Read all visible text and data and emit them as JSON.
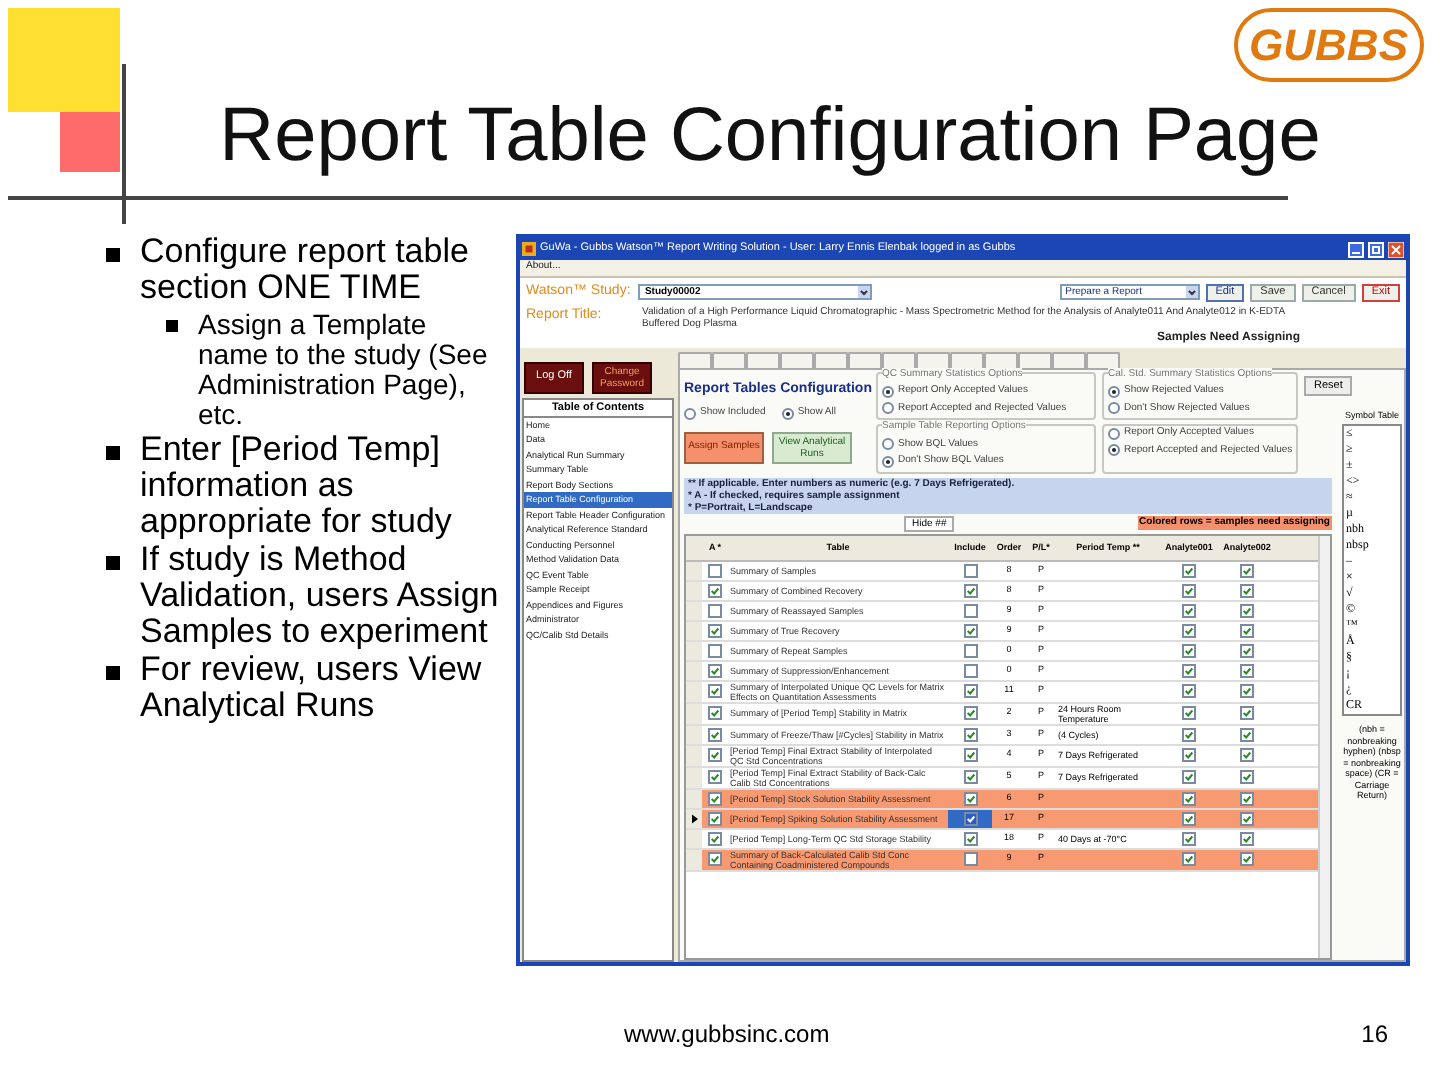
{
  "slide": {
    "logo": "GUBBS",
    "title": "Report Table Configuration Page",
    "bullets": [
      {
        "text": "Configure report table section ONE TIME",
        "children": [
          {
            "text": "Assign a Template name to the study (See Administration Page), etc."
          }
        ]
      },
      {
        "text": "Enter [Period Temp] information as appropriate for study"
      },
      {
        "text": "If study is Method Validation, users Assign Samples to experiment"
      },
      {
        "text": "For review, users View Analytical Runs"
      }
    ],
    "footer_url": "www.gubbsinc.com",
    "page_number": "16"
  },
  "app": {
    "title": "GuWa - Gubbs Watson™ Report Writing Solution - User: Larry Ennis Elenbak logged in as Gubbs",
    "menu": [
      "About..."
    ],
    "study_label": "Watson™ Study:",
    "study_value": "Study00002",
    "action_value": "Prepare a Report",
    "buttons": [
      {
        "label": "Edit",
        "kind": "edit"
      },
      {
        "label": "Save",
        "kind": "plain"
      },
      {
        "label": "Cancel",
        "kind": "plain"
      },
      {
        "label": "Exit",
        "kind": "exit"
      }
    ],
    "report_title_label": "Report Title:",
    "report_title": "Validation of a High Performance Liquid Chromatographic - Mass Spectrometric Method for the Analysis of Analyte011 And Analyte012 in K-EDTA Buffered Dog Plasma",
    "status": "Samples Need Assigning",
    "log_off": "Log Off",
    "change_password": "Change Password",
    "toc_title": "Table of Contents",
    "toc": [
      {
        "label": "Home",
        "selected": false
      },
      {
        "label": "Data",
        "selected": false
      },
      {
        "label": "Analytical Run Summary",
        "selected": false
      },
      {
        "label": "Summary Table",
        "selected": false
      },
      {
        "label": "Report Body Sections",
        "selected": false
      },
      {
        "label": "Report Table Configuration",
        "selected": true
      },
      {
        "label": "Report Table Header Configuration",
        "selected": false
      },
      {
        "label": "Analytical Reference Standard",
        "selected": false
      },
      {
        "label": "Conducting Personnel",
        "selected": false
      },
      {
        "label": "Method Validation Data",
        "selected": false
      },
      {
        "label": "QC Event Table",
        "selected": false
      },
      {
        "label": "Sample Receipt",
        "selected": false
      },
      {
        "label": "Appendices and Figures",
        "selected": false
      },
      {
        "label": "Administrator",
        "selected": false
      },
      {
        "label": "QC/Calib Std Details",
        "selected": false
      }
    ],
    "section_title": "Report Tables Configuration",
    "view_filter": [
      {
        "label": "Show Included",
        "selected": false
      },
      {
        "label": "Show All",
        "selected": true
      }
    ],
    "assign_samples": "Assign Samples",
    "view_runs": "View Analytical Runs",
    "option_groups": [
      {
        "title": "QC Summary Statistics Options",
        "options": [
          {
            "label": "Report Only Accepted Values",
            "selected": true
          },
          {
            "label": "Report Accepted and Rejected Values",
            "selected": false
          }
        ]
      },
      {
        "title": "Cal. Std. Summary Statistics Options",
        "options": [
          {
            "label": "Show Rejected Values",
            "selected": true
          },
          {
            "label": "Don't Show Rejected Values",
            "selected": false
          }
        ]
      },
      {
        "title": "Sample Table Reporting Options",
        "options": [
          {
            "label": "Show BQL Values",
            "selected": false
          },
          {
            "label": "Don't Show BQL Values",
            "selected": true
          }
        ]
      },
      {
        "options": [
          {
            "label": "Report Only Accepted Values",
            "selected": false
          },
          {
            "label": "Report Accepted and Rejected Values",
            "selected": true
          }
        ]
      }
    ],
    "reset": "Reset",
    "notes": [
      "** If applicable. Enter numbers as numeric (e.g. 7 Days Refrigerated).",
      "* A - If checked, requires sample assignment",
      "* P=Portrait, L=Landscape"
    ],
    "hide_button": "Hide ##",
    "legend": "Colored rows = samples need assigning",
    "columns": [
      "A *",
      "Table",
      "Include",
      "Order",
      "P/L*",
      "Period Temp **",
      "Analyte001",
      "Analyte002"
    ],
    "rows": [
      {
        "a": false,
        "table": "Summary of Samples",
        "include": false,
        "order": "8",
        "pl": "P",
        "a1": true,
        "a2": true,
        "needs_assigning": false,
        "selected": false
      },
      {
        "a": true,
        "table": "Summary of Combined Recovery",
        "include": true,
        "order": "8",
        "pl": "P",
        "a1": true,
        "a2": true,
        "needs_assigning": false,
        "selected": false
      },
      {
        "a": false,
        "table": "Summary of Reassayed Samples",
        "include": false,
        "order": "9",
        "pl": "P",
        "a1": true,
        "a2": true,
        "needs_assigning": false,
        "selected": false
      },
      {
        "a": true,
        "table": "Summary of True Recovery",
        "include": true,
        "order": "9",
        "pl": "P",
        "a1": true,
        "a2": true,
        "needs_assigning": false,
        "selected": false
      },
      {
        "a": false,
        "table": "Summary of Repeat Samples",
        "include": false,
        "order": "0",
        "pl": "P",
        "a1": true,
        "a2": true,
        "needs_assigning": false,
        "selected": false
      },
      {
        "a": true,
        "table": "Summary of Suppression/Enhancement",
        "include": false,
        "order": "0",
        "pl": "P",
        "a1": true,
        "a2": true,
        "needs_assigning": false,
        "selected": false
      },
      {
        "a": true,
        "table": "Summary of Interpolated Unique QC Levels for Matrix Effects on Quantitation Assessments",
        "include": true,
        "order": "11",
        "pl": "P",
        "a1": true,
        "a2": true,
        "needs_assigning": false,
        "selected": false
      },
      {
        "a": true,
        "table": "Summary of [Period Temp] Stability in Matrix",
        "include": true,
        "order": "2",
        "pl": "P",
        "period": "24 Hours Room Temperature",
        "a1": true,
        "a2": true,
        "needs_assigning": false,
        "selected": false
      },
      {
        "a": true,
        "table": "Summary of Freeze/Thaw [#Cycles] Stability in Matrix",
        "include": true,
        "order": "3",
        "pl": "P",
        "period": "(4 Cycles)",
        "a1": true,
        "a2": true,
        "needs_assigning": false,
        "selected": false
      },
      {
        "a": true,
        "table": "[Period Temp] Final Extract Stability of Interpolated QC Std Concentrations",
        "include": true,
        "order": "4",
        "pl": "P",
        "period": "7 Days Refrigerated",
        "a1": true,
        "a2": true,
        "needs_assigning": false,
        "selected": false
      },
      {
        "a": true,
        "table": "[Period Temp] Final Extract Stability of Back-Calc Calib Std Concentrations",
        "include": true,
        "order": "5",
        "pl": "P",
        "period": "7 Days Refrigerated",
        "a1": true,
        "a2": true,
        "needs_assigning": false,
        "selected": false
      },
      {
        "a": true,
        "table": "[Period Temp] Stock Solution Stability Assessment",
        "include": true,
        "order": "6",
        "pl": "P",
        "a1": true,
        "a2": true,
        "needs_assigning": true,
        "selected": false
      },
      {
        "a": true,
        "table": "[Period Temp] Spiking Solution Stability Assessment",
        "include": true,
        "order": "17",
        "pl": "P",
        "a1": true,
        "a2": true,
        "needs_assigning": true,
        "selected": true
      },
      {
        "a": true,
        "table": "[Period Temp] Long-Term QC Std Storage Stability",
        "include": true,
        "order": "18",
        "pl": "P",
        "period": "40 Days at -70°C",
        "a1": true,
        "a2": true,
        "needs_assigning": false,
        "selected": false
      },
      {
        "a": true,
        "table": "Summary of Back-Calculated Calib Std Conc Containing Coadministered Compounds",
        "include": false,
        "order": "9",
        "pl": "P",
        "a1": true,
        "a2": true,
        "needs_assigning": true,
        "selected": false
      }
    ],
    "symbol_title": "Symbol Table",
    "symbols": [
      "≤",
      "≥",
      "±",
      "<>",
      "≈",
      "µ",
      "nbh",
      "nbsp",
      "–",
      "×",
      "√",
      "©",
      "™",
      "Å",
      "§",
      "¡",
      "¿",
      "CR"
    ],
    "symbol_notes": "(nbh = nonbreaking hyphen) (nbsp = nonbreaking space) (CR = Carriage Return)"
  }
}
